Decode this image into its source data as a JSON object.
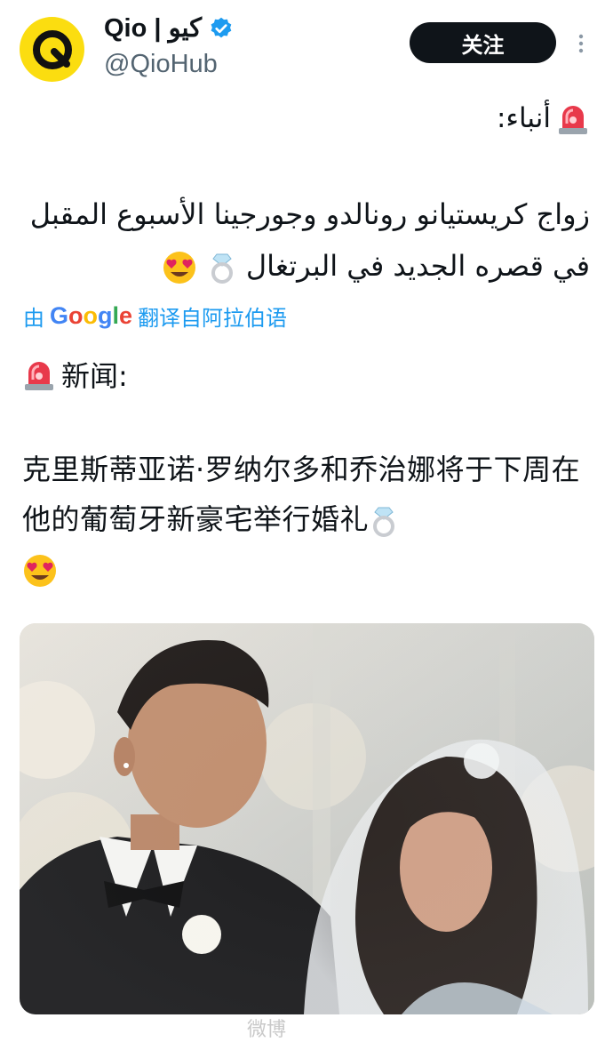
{
  "header": {
    "display_name": "Qio | كيو",
    "handle": "@QioHub",
    "follow_label": "关注"
  },
  "tweet": {
    "arabic_heading": "أنباء:",
    "arabic_body": "زواج كريستيانو رونالدو وجورجينا الأسبوع المقبل في قصره الجديد في البرتغال",
    "translate_prefix": "由",
    "translate_brand": "Google",
    "translate_suffix": "翻译自阿拉伯语",
    "chinese_heading": "新闻:",
    "chinese_body": "克里斯蒂亚诺·罗纳尔多和乔治娜将于下周在他的葡萄牙新豪宅举行婚礼"
  },
  "icons": {
    "siren": "rotating-light-emoji",
    "ring": "ring-emoji",
    "heart_eyes": "heart-eyes-emoji",
    "verified": "verified-badge-icon"
  },
  "colors": {
    "follow_bg": "#0f1419",
    "link": "#1d9bf0",
    "avatar_bg": "#fbdd10",
    "verified": "#1d9bf0"
  },
  "watermark": "微博"
}
